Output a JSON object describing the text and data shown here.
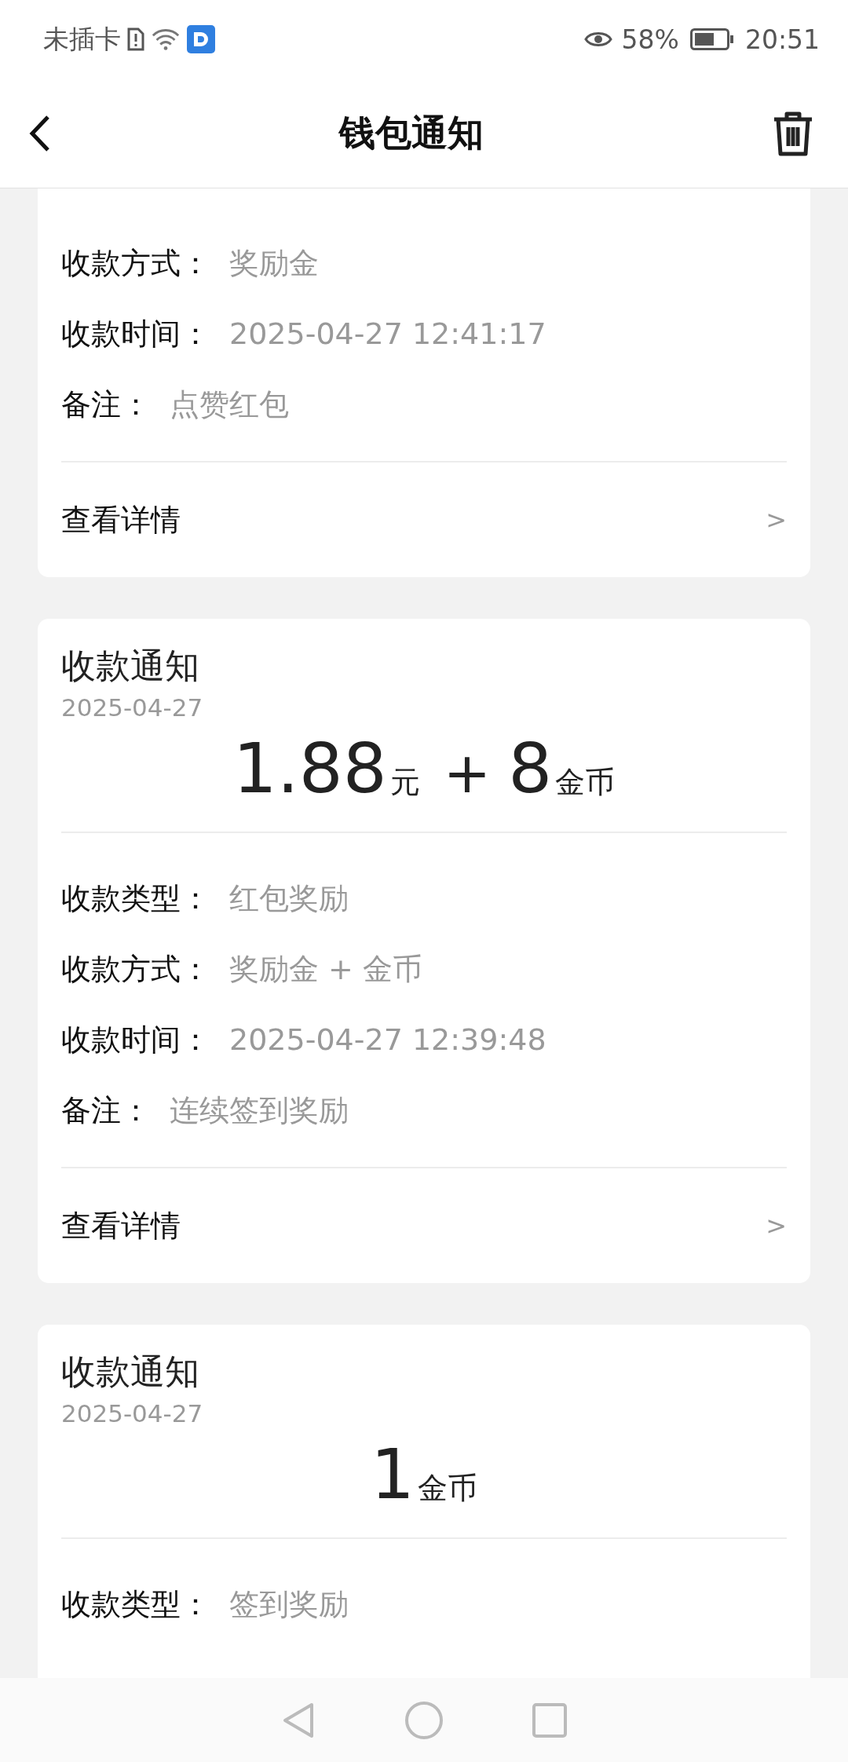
{
  "status_bar": {
    "carrier": "未插卡",
    "battery_text": "58%",
    "time": "20:51"
  },
  "header": {
    "title": "钱包通知"
  },
  "cards": [
    {
      "rows": [
        {
          "label": "收款方式：",
          "value": "奖励金"
        },
        {
          "label": "收款时间：",
          "value": "2025-04-27 12:41:17"
        },
        {
          "label": "备注：",
          "value": "点赞红包"
        }
      ],
      "detail": {
        "label": "查看详情",
        "arrow": ">"
      }
    },
    {
      "title": "收款通知",
      "date": "2025-04-27",
      "amount": [
        {
          "kind": "number",
          "text": "1.88"
        },
        {
          "kind": "unit",
          "text": "元"
        },
        {
          "kind": "plus",
          "text": "+"
        },
        {
          "kind": "number",
          "text": "8"
        },
        {
          "kind": "unit",
          "text": "金币"
        }
      ],
      "rows": [
        {
          "label": "收款类型：",
          "value": "红包奖励"
        },
        {
          "label": "收款方式：",
          "value": "奖励金 + 金币"
        },
        {
          "label": "收款时间：",
          "value": "2025-04-27 12:39:48"
        },
        {
          "label": "备注：",
          "value": "连续签到奖励"
        }
      ],
      "detail": {
        "label": "查看详情",
        "arrow": ">"
      }
    },
    {
      "title": "收款通知",
      "date": "2025-04-27",
      "amount": [
        {
          "kind": "number",
          "text": "1"
        },
        {
          "kind": "unit",
          "text": "金币"
        }
      ],
      "rows": [
        {
          "label": "收款类型：",
          "value": "签到奖励"
        }
      ]
    }
  ]
}
